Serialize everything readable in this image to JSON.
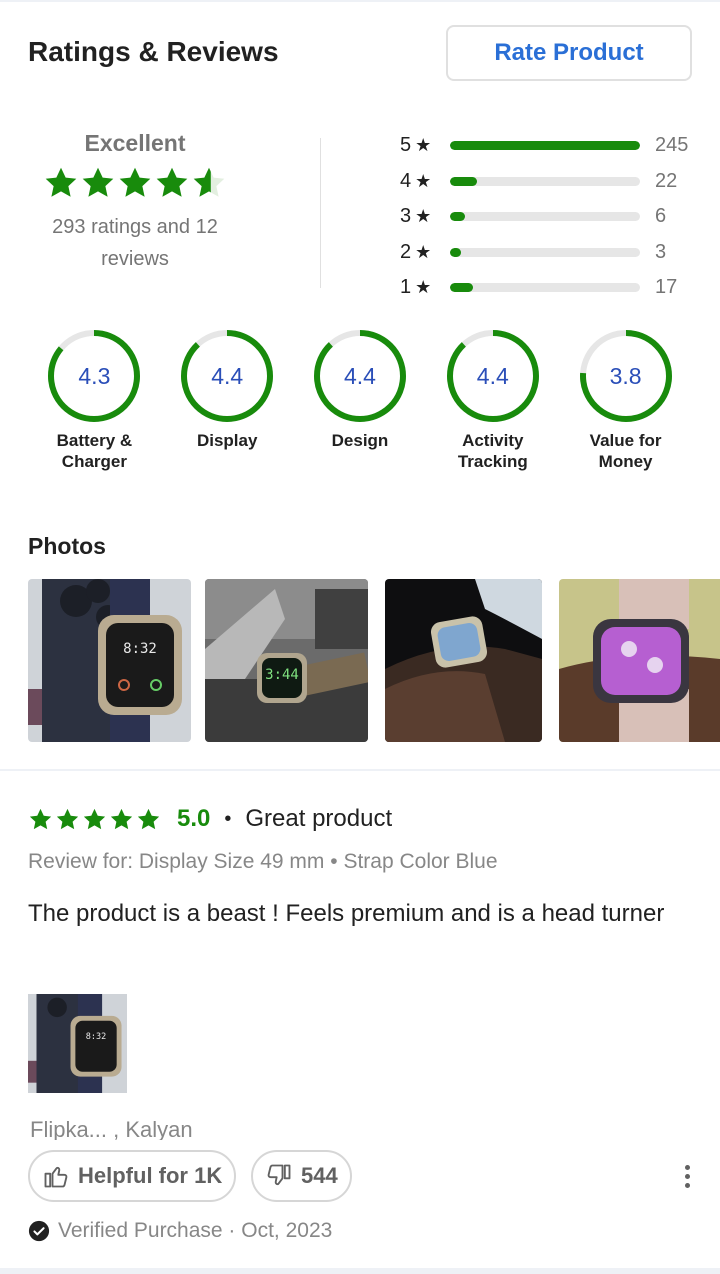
{
  "header": {
    "title": "Ratings & Reviews",
    "rate_button": "Rate Product"
  },
  "summary": {
    "label": "Excellent",
    "rating": 4.3,
    "count_text": "293 ratings and 12 reviews",
    "star_color": "#188b0c"
  },
  "distribution": [
    {
      "stars": "5",
      "count": "245",
      "fraction": 1.0
    },
    {
      "stars": "4",
      "count": "22",
      "fraction": 0.14
    },
    {
      "stars": "3",
      "count": "6",
      "fraction": 0.08
    },
    {
      "stars": "2",
      "count": "3",
      "fraction": 0.06
    },
    {
      "stars": "1",
      "count": "17",
      "fraction": 0.12
    }
  ],
  "aspects": [
    {
      "value": "4.3",
      "name": "Battery & Charger",
      "fraction": 0.86
    },
    {
      "value": "4.4",
      "name": "Display",
      "fraction": 0.88
    },
    {
      "value": "4.4",
      "name": "Design",
      "fraction": 0.88
    },
    {
      "value": "4.4",
      "name": "Activity Tracking",
      "fraction": 0.88
    },
    {
      "value": "3.8",
      "name": "Value for Money",
      "fraction": 0.76
    }
  ],
  "photos": {
    "title": "Photos"
  },
  "review": {
    "rating": 5,
    "score": "5.0",
    "dot": "•",
    "title": "Great product",
    "variant": "Review for: Display Size 49 mm • Strap Color Blue",
    "text": "The product is a beast ! Feels premium and is a head turner",
    "reviewer": "Flipka... , Kalyan",
    "helpful_label": "Helpful for 1K",
    "dislike_count": "544",
    "verified": "Verified Purchase · Oct, 2023"
  },
  "icons": {
    "star": "star-icon",
    "thumbs_up": "thumbs-up-icon",
    "thumbs_down": "thumbs-down-icon",
    "more": "more-vertical-icon",
    "verified": "check-circle-icon"
  },
  "colors": {
    "accent_green": "#188b0c",
    "link_blue": "#2a6fd6",
    "aspect_value_blue": "#2a4eb8",
    "muted_text": "#878787"
  }
}
